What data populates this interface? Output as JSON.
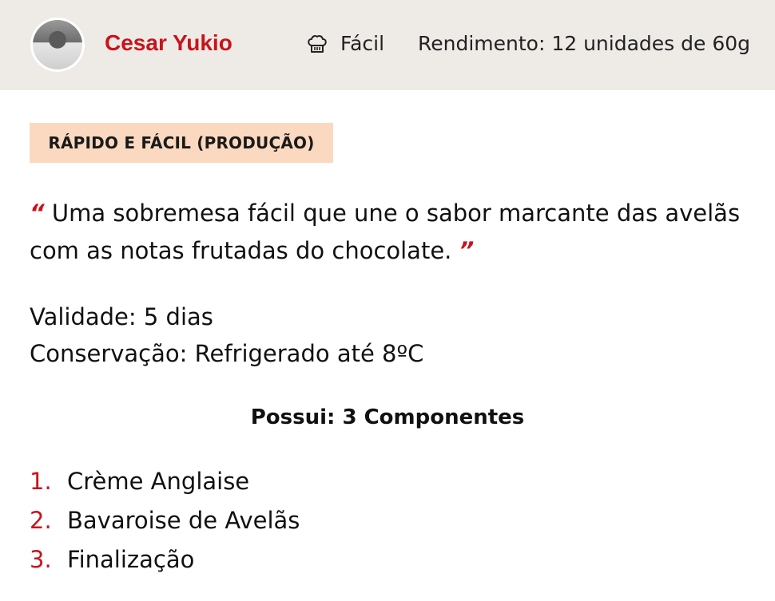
{
  "header": {
    "author_name": "Cesar Yukio",
    "avatar_icon": "avatar-photo",
    "difficulty_icon": "chef-hat-icon",
    "difficulty": "Fácil",
    "yield": "Rendimento: 12 unidades de 60g"
  },
  "tag": {
    "label": "RÁPIDO E FÁCIL (PRODUÇÃO)"
  },
  "quote": {
    "open_mark": "“",
    "text": "Uma sobremesa fácil que une o sabor marcante das avelãs com as notas frutadas do chocolate.",
    "close_mark": "”"
  },
  "details": {
    "validity": "Validade:  5 dias",
    "conservation": "Conservação:  Refrigerado até 8ºC"
  },
  "components": {
    "title": "Possui: 3 Componentes",
    "items": [
      {
        "number": "1.",
        "label": "Crème Anglaise"
      },
      {
        "number": "2.",
        "label": "Bavaroise de Avelãs"
      },
      {
        "number": "3.",
        "label": "Finalização"
      }
    ]
  },
  "colors": {
    "accent": "#c8141c",
    "header_bg": "#eeebe6",
    "tag_bg": "#fbd9c0"
  }
}
